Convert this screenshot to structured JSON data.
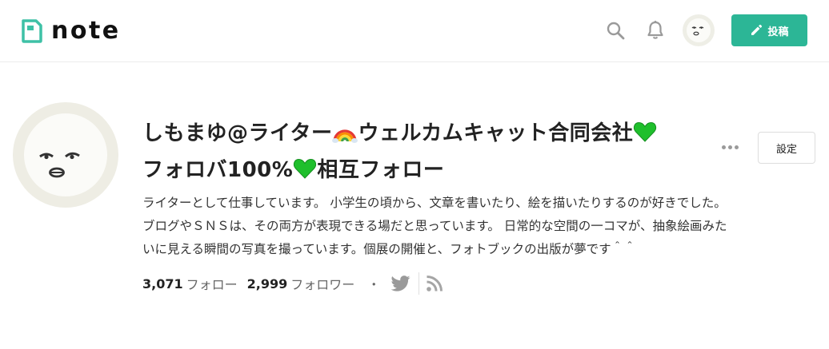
{
  "header": {
    "logo_text": "note",
    "post_button_label": "投稿"
  },
  "profile": {
    "name_part1": "しもまゆ@ライター",
    "name_part2": "ウェルカムキャット合同会社",
    "name_part3": "フォロバ100%",
    "name_part4": "相互フォロー",
    "bio_line1": "ライターとして仕事しています。 小学生の頃から、文章を書いたり、絵を描いたりするのが好きでした。",
    "bio_line2": "ブログやＳＮＳは、その両方が表現できる場だと思っています。 日常的な空間の一コマが、抽象絵画みた",
    "bio_line3": "いに見える瞬間の写真を撮っています。個展の開催と、フォトブックの出版が夢です＾＾",
    "settings_label": "設定"
  },
  "stats": {
    "following_count": "3,071",
    "following_label": "フォロー",
    "followers_count": "2,999",
    "followers_label": "フォロワー",
    "separator": "・"
  },
  "colors": {
    "brand_green": "#2cb696",
    "heart_green": "#1fbf2c"
  },
  "icons": [
    "note-logo-icon",
    "search-icon",
    "bell-icon",
    "avatar",
    "pencil-icon",
    "rainbow-icon",
    "green-heart-icon",
    "more-icon",
    "twitter-icon",
    "rss-icon"
  ]
}
